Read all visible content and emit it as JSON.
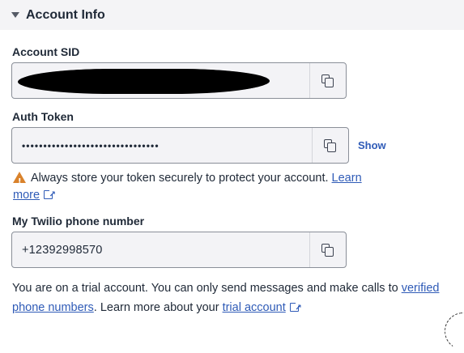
{
  "section": {
    "title": "Account Info"
  },
  "account_sid": {
    "label": "Account SID",
    "value": ""
  },
  "auth_token": {
    "label": "Auth Token",
    "value": "••••••••••••••••••••••••••••••••",
    "show_label": "Show"
  },
  "warning": {
    "text": "Always store your token securely to protect your account.",
    "link_label": "Learn more"
  },
  "phone": {
    "label": "My Twilio phone number",
    "value": "+12392998570"
  },
  "trial": {
    "text_before": "You are on a trial account. You can only send messages and make calls to ",
    "link1": "verified phone numbers",
    "text_middle": ". Learn more about your ",
    "link2": "trial account"
  },
  "colors": {
    "link": "#2f5bb7",
    "warning": "#d9822b",
    "header_bg": "#f4f4f6"
  },
  "icons": [
    "caret-down-icon",
    "copy-icon",
    "warning-icon",
    "external-link-icon",
    "loading-spinner-icon"
  ]
}
